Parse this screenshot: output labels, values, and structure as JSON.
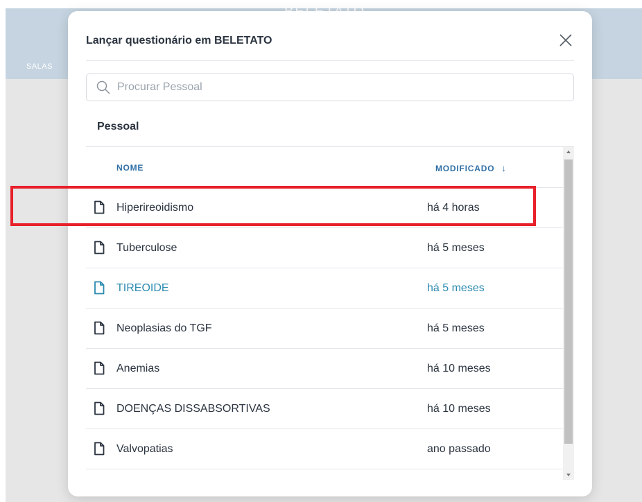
{
  "background": {
    "header_title": "BELETATO",
    "nav_label": "SALAS"
  },
  "modal": {
    "title": "Lançar questionário em BELETATO",
    "close_icon": "close-icon",
    "search": {
      "placeholder": "Procurar Pessoal",
      "value": ""
    },
    "section_title": "Pessoal",
    "table": {
      "columns": {
        "name": "NOME",
        "modified": "MODIFICADO",
        "sort_icon": "arrow-down-icon"
      },
      "rows": [
        {
          "name": "Hiperireoidismo",
          "modified": "há 4 horas"
        },
        {
          "name": "Tuberculose",
          "modified": "há 5 meses"
        },
        {
          "name": "TIREOIDE",
          "modified": "há 5 meses"
        },
        {
          "name": "Neoplasias do TGF",
          "modified": "há 5 meses"
        },
        {
          "name": "Anemias",
          "modified": "há 10 meses"
        },
        {
          "name": "DOENÇAS DISSABSORTIVAS",
          "modified": "há 10 meses"
        },
        {
          "name": "Valvopatias",
          "modified": "ano passado"
        }
      ]
    }
  },
  "colors": {
    "accent": "#2b8ab0",
    "header_link": "#2f6fa6",
    "highlight": "#e8202a",
    "backdrop_header": "#c5d4e0"
  }
}
